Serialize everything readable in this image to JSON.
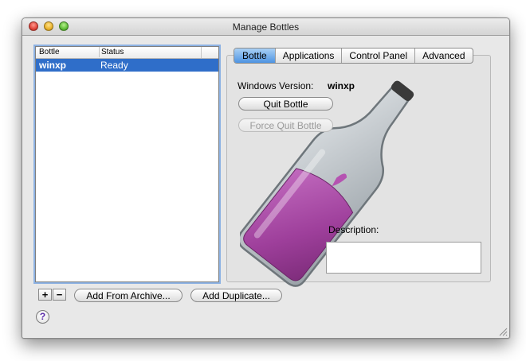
{
  "window": {
    "title": "Manage Bottles"
  },
  "bottle_list": {
    "columns": [
      "Bottle",
      "Status"
    ],
    "rows": [
      {
        "bottle": "winxp",
        "status": "Ready"
      }
    ]
  },
  "tabs": [
    {
      "label": "Bottle",
      "active": true
    },
    {
      "label": "Applications",
      "active": false
    },
    {
      "label": "Control Panel",
      "active": false
    },
    {
      "label": "Advanced",
      "active": false
    }
  ],
  "bottle_tab": {
    "windows_version_label": "Windows Version:",
    "windows_version_value": "winxp",
    "quit_button": "Quit Bottle",
    "force_quit_button": "Force Quit Bottle",
    "description_label": "Description:",
    "description_value": ""
  },
  "footer": {
    "add_button": "+",
    "remove_button": "−",
    "add_from_archive_button": "Add From Archive...",
    "add_duplicate_button": "Add Duplicate...",
    "help_icon": "?"
  },
  "colors": {
    "selection": "#2f6ec9",
    "tab_active": "#4f94e3",
    "wine": "#a0449e"
  }
}
